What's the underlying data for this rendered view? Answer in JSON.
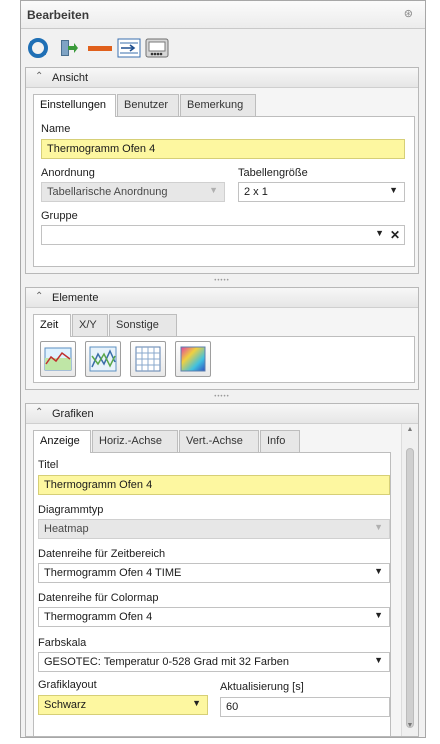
{
  "panel": {
    "title": "Bearbeiten",
    "pin_icon": "pin-icon"
  },
  "toolbar": {
    "icons": [
      "refresh-icon",
      "exit-icon",
      "line-style-icon",
      "arrow-indent-icon",
      "display-icon"
    ]
  },
  "ansicht": {
    "header": "Ansicht",
    "tabs": [
      "Einstellungen",
      "Benutzer",
      "Bemerkung"
    ],
    "name_label": "Name",
    "name_value": "Thermogramm Ofen 4",
    "anordnung_label": "Anordnung",
    "anordnung_value": "Tabellarische Anordnung",
    "tabellengroesse_label": "Tabellengröße",
    "tabellengroesse_value": "2 x 1",
    "gruppe_label": "Gruppe",
    "gruppe_value": ""
  },
  "elemente": {
    "header": "Elemente",
    "tabs": [
      "Zeit",
      "X/Y",
      "Sonstige"
    ],
    "buttons": [
      "line-chart-icon",
      "xy-chart-icon",
      "table-grid-icon",
      "heatmap-icon"
    ]
  },
  "grafiken": {
    "header": "Grafiken",
    "tabs": [
      "Anzeige",
      "Horiz.-Achse",
      "Vert.-Achse",
      "Info"
    ],
    "titel_label": "Titel",
    "titel_value": "Thermogramm Ofen 4",
    "diagrammtyp_label": "Diagrammtyp",
    "diagrammtyp_value": "Heatmap",
    "zeitbereich_label": "Datenreihe für Zeitbereich",
    "zeitbereich_value": "Thermogramm Ofen 4 TIME",
    "colormap_label": "Datenreihe für Colormap",
    "colormap_value": "Thermogramm Ofen 4",
    "farbskala_label": "Farbskala",
    "farbskala_value": "GESOTEC: Temperatur 0-528 Grad mit 32 Farben",
    "grafiklayout_label": "Grafiklayout",
    "grafiklayout_value": "Schwarz",
    "aktualisierung_label": "Aktualisierung [s]",
    "aktualisierung_value": "60"
  },
  "colors": {
    "highlight_yellow": "#fdf7a0",
    "toolbar_orange": "#e0601c"
  }
}
